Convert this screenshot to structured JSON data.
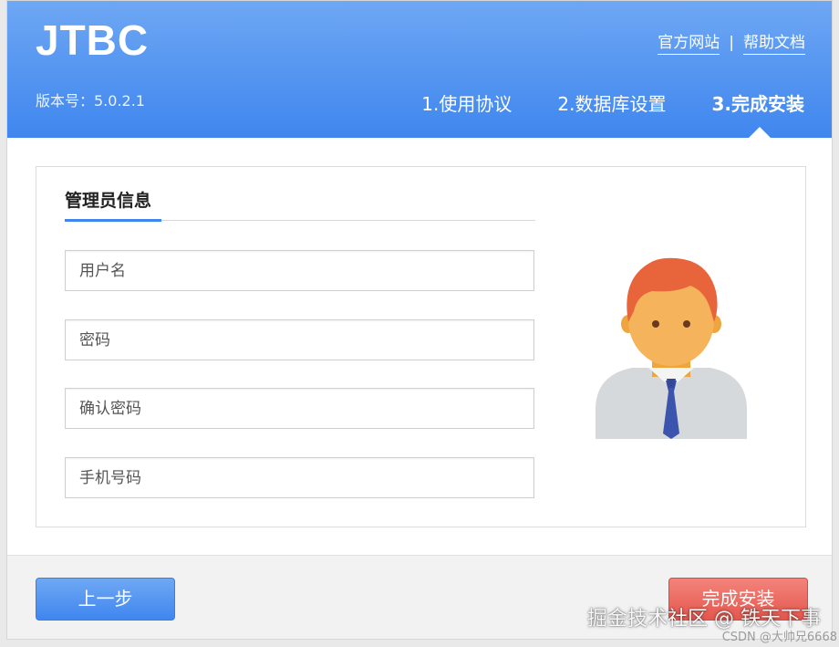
{
  "header": {
    "logo": "JTBC",
    "version": "版本号：5.0.2.1",
    "links": {
      "official_site": "官方网站",
      "separator": "|",
      "help_docs": "帮助文档"
    },
    "steps": [
      "1.使用协议",
      "2.数据库设置",
      "3.完成安装"
    ],
    "active_step": 3
  },
  "form": {
    "title": "管理员信息",
    "fields": {
      "username_placeholder": "用户名",
      "password_placeholder": "密码",
      "confirm_password_placeholder": "确认密码",
      "phone_placeholder": "手机号码"
    }
  },
  "footer": {
    "prev_label": "上一步",
    "finish_label": "完成安装"
  },
  "watermark": {
    "main": "掘金技术社区 @ 铁天下事",
    "sub": "CSDN @大帅兄6668"
  },
  "colors": {
    "accent": "#3f86ee",
    "finish": "#e4574d"
  }
}
